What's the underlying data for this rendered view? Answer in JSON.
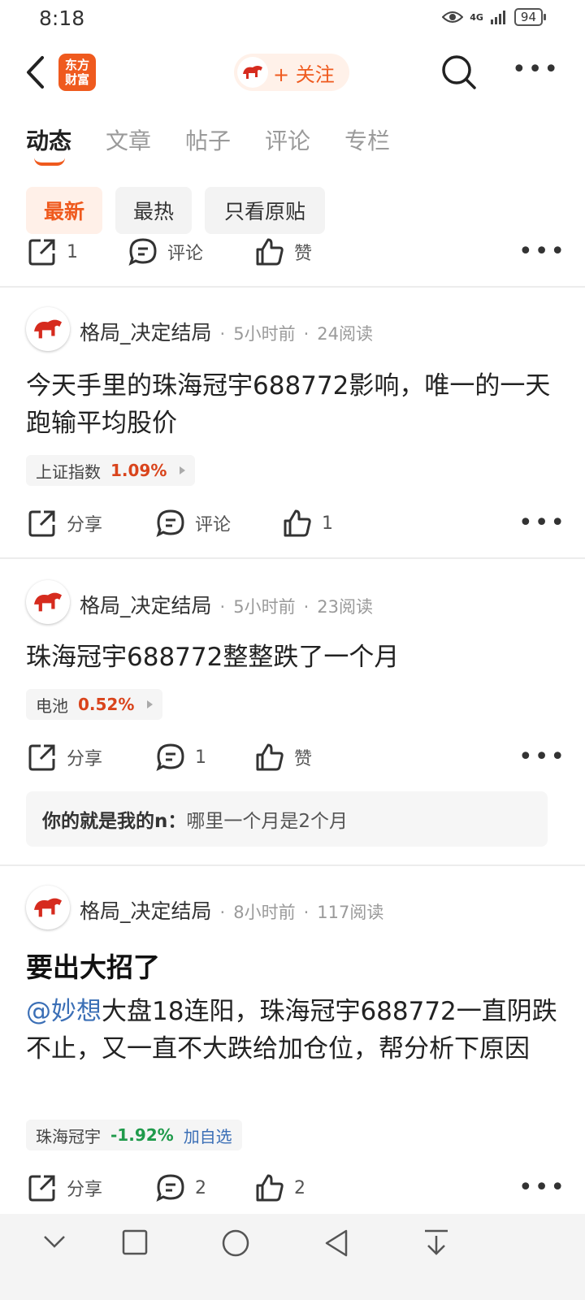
{
  "status_bar": {
    "time": "8:18",
    "network": "4G",
    "battery": "94"
  },
  "header": {
    "logo_text": "东方\n财富",
    "follow_label": "+ 关注"
  },
  "tabs": [
    {
      "label": "动态",
      "active": true
    },
    {
      "label": "文章"
    },
    {
      "label": "帖子"
    },
    {
      "label": "评论"
    },
    {
      "label": "专栏"
    }
  ],
  "filters": [
    {
      "label": "最新",
      "active": true
    },
    {
      "label": "最热"
    },
    {
      "label": "只看原贴"
    }
  ],
  "top_actions": {
    "share": "1",
    "comment": "评论",
    "like": "赞"
  },
  "posts": [
    {
      "author": "格局_决定结局",
      "time": "5小时前",
      "reads": "24阅读",
      "text": "今天手里的珠海冠宇688772影响，唯一的一天跑输平均股价",
      "stock": {
        "name": "上证指数",
        "change": "1.09%"
      },
      "actions": {
        "share": "分享",
        "comment": "评论",
        "like": "1"
      }
    },
    {
      "author": "格局_决定结局",
      "time": "5小时前",
      "reads": "23阅读",
      "text": "珠海冠宇688772整整跌了一个月",
      "stock": {
        "name": "电池",
        "change": "0.52%"
      },
      "actions": {
        "share": "分享",
        "comment": "1",
        "like": "赞"
      },
      "reply": {
        "user": "你的就是我的n：",
        "text": "哪里一个月是2个月"
      }
    },
    {
      "author": "格局_决定结局",
      "time": "8小时前",
      "reads": "117阅读",
      "title": "要出大招了",
      "mention": "@妙想",
      "text": "大盘18连阳，珠海冠宇688772一直阴跌不止，又一直不大跌给加仓位，帮分析下原因",
      "stock": {
        "name": "珠海冠宇",
        "change": "-1.92%",
        "add": "加自选"
      },
      "actions": {
        "share": "分享",
        "comment": "2",
        "like": "2"
      }
    }
  ],
  "colors": {
    "accent": "#ef5a1e",
    "up": "#d9441c",
    "down": "#1f9a4b",
    "link": "#3b6fb6"
  }
}
